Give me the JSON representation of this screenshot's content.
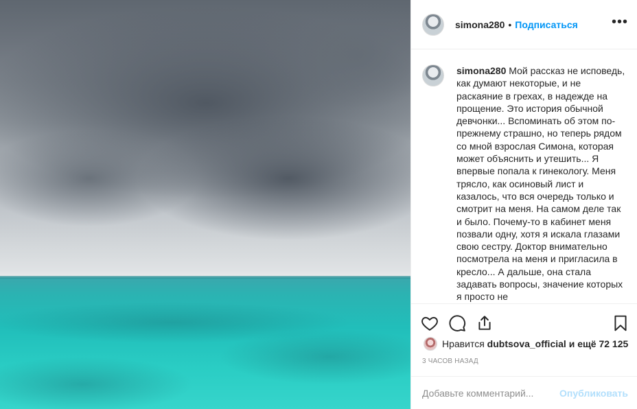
{
  "post": {
    "username": "simona280",
    "separator": "•",
    "follow_label": "Подписаться",
    "more_label": "•••",
    "caption_username": "simona280",
    "caption_text": "Мой рассказ не исповедь, как думают некоторые, и не раскаяние в грехах, в надежде на прощение. Это история обычной девчонки... Вспоминать об этом по- прежнему страшно, но теперь рядом со мной взрослая Симона, которая может объяснить и утешить... Я впервые попала к гинекологу. Меня трясло, как осиновый лист и казалось, что вся очередь только и смотрит на меня. На самом деле так и было. Почему-то в кабинет меня позвали одну, хотя я искала глазами свою сестру. Доктор внимательно посмотрела на меня и пригласила в кресло... А дальше, она стала задавать вопросы, значение которых я просто не",
    "likes_prefix": "Нравится",
    "likes_user": "dubtsova_official",
    "likes_suffix": "и ещё 72 125",
    "timestamp": "3 ЧАСОВ НАЗАД",
    "comment_placeholder": "Добавьте комментарий...",
    "publish_label": "Опубликовать"
  },
  "icons": {
    "like": "heart-icon",
    "comment": "comment-icon",
    "share": "share-icon",
    "save": "bookmark-icon"
  },
  "colors": {
    "link_blue": "#0095f6",
    "publish_disabled": "#b2dffc",
    "muted": "#8e8e8e"
  }
}
